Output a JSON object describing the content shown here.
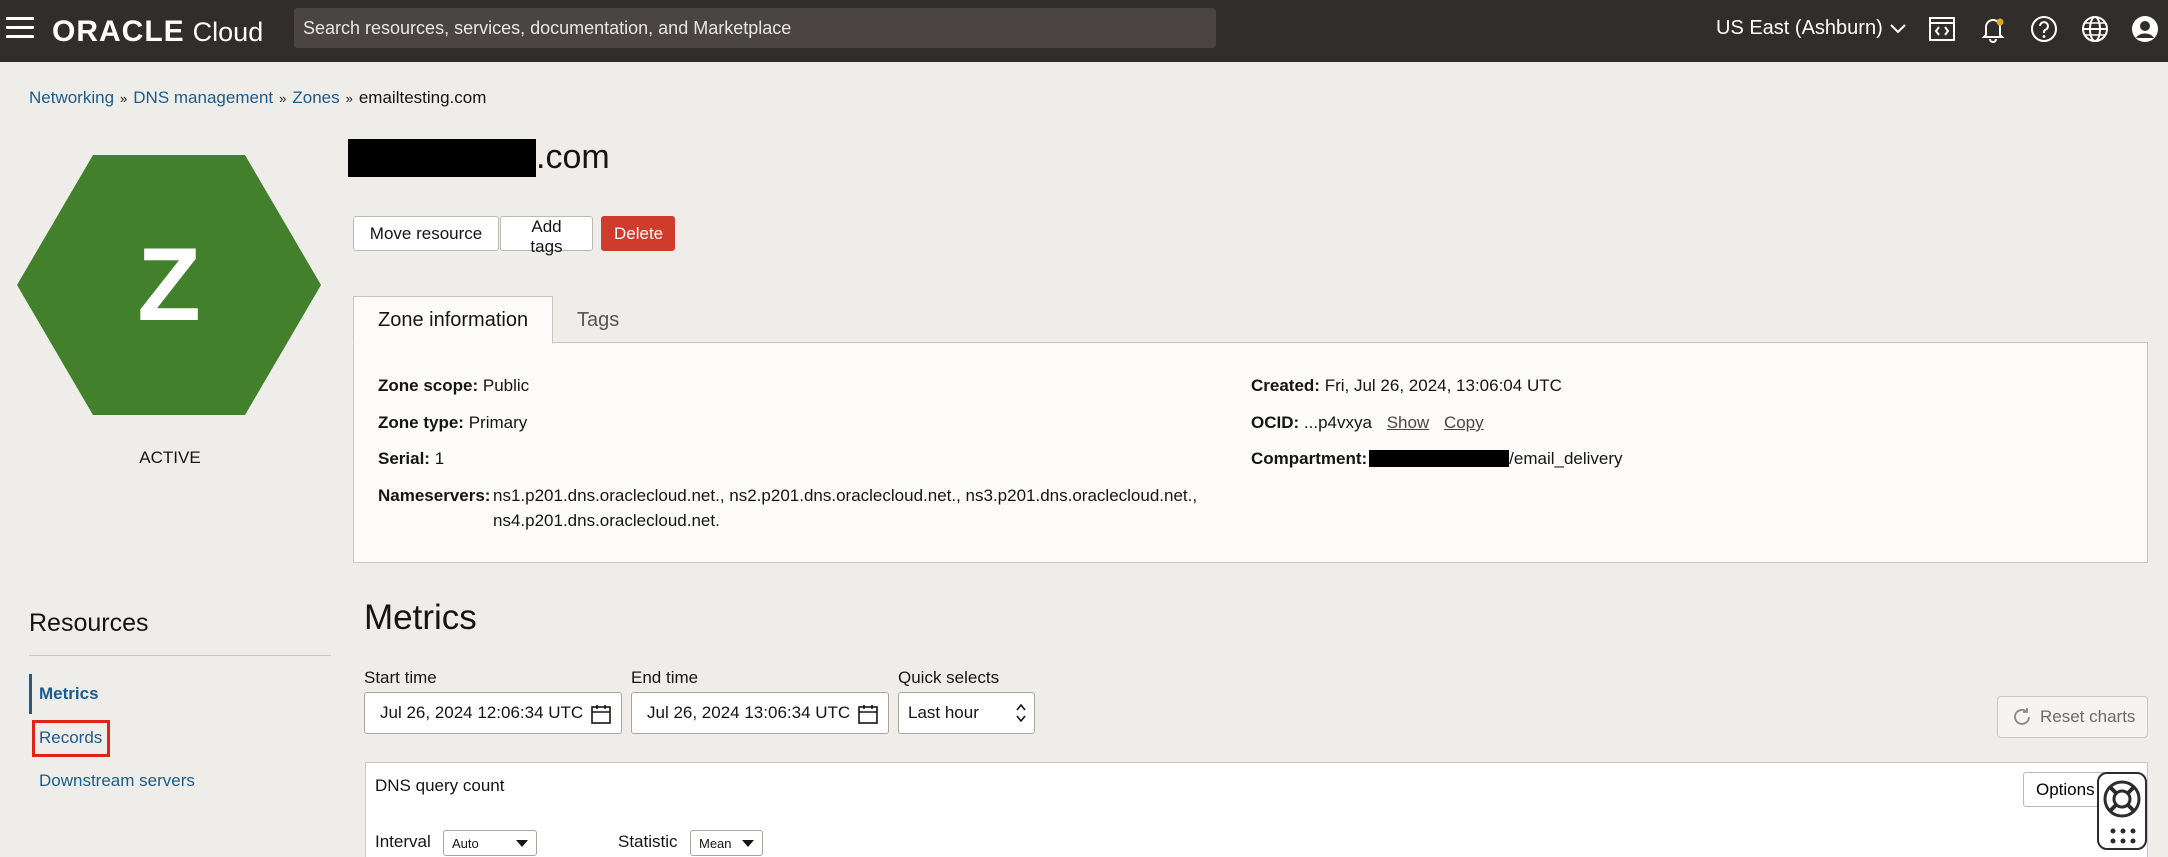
{
  "header": {
    "brand_oracle": "ORACLE",
    "brand_cloud": "Cloud",
    "search_placeholder": "Search resources, services, documentation, and Marketplace",
    "region": "US East (Ashburn)"
  },
  "breadcrumb": {
    "items": [
      "Networking",
      "DNS management",
      "Zones"
    ],
    "current": "emailtesting.com"
  },
  "zone": {
    "icon_letter": "Z",
    "status": "ACTIVE",
    "title_suffix": ".com"
  },
  "actions": {
    "move": "Move resource",
    "add_tags": "Add tags",
    "delete": "Delete"
  },
  "tabs": {
    "zone_information": "Zone information",
    "tags": "Tags"
  },
  "info": {
    "scope_label": "Zone scope:",
    "scope_value": "Public",
    "type_label": "Zone type:",
    "type_value": "Primary",
    "serial_label": "Serial:",
    "serial_value": "1",
    "nameservers_label": "Nameservers:",
    "nameservers_line1": "ns1.p201.dns.oraclecloud.net., ns2.p201.dns.oraclecloud.net., ns3.p201.dns.oraclecloud.net.,",
    "nameservers_line2": "ns4.p201.dns.oraclecloud.net.",
    "created_label": "Created:",
    "created_value": "Fri, Jul 26, 2024, 13:06:04 UTC",
    "ocid_label": "OCID:",
    "ocid_value": "...p4vxya",
    "ocid_show": "Show",
    "ocid_copy": "Copy",
    "compartment_label": "Compartment:",
    "compartment_suffix": "/email_delivery"
  },
  "resources": {
    "title": "Resources",
    "items": [
      "Metrics",
      "Records",
      "Downstream servers"
    ]
  },
  "metrics": {
    "title": "Metrics",
    "start_label": "Start time",
    "start_value": "Jul 26, 2024 12:06:34 UTC",
    "end_label": "End time",
    "end_value": "Jul 26, 2024 13:06:34 UTC",
    "quick_label": "Quick selects",
    "quick_value": "Last hour",
    "reset": "Reset charts"
  },
  "chart": {
    "title": "DNS query count",
    "options": "Options",
    "interval_label": "Interval",
    "interval_value": "Auto",
    "statistic_label": "Statistic",
    "statistic_value": "Mean"
  },
  "colors": {
    "topbar": "#312d2a",
    "hexagon": "#42802b",
    "delete": "#d03c2c",
    "link": "#1b5c8c",
    "highlight": "#e0241a"
  }
}
